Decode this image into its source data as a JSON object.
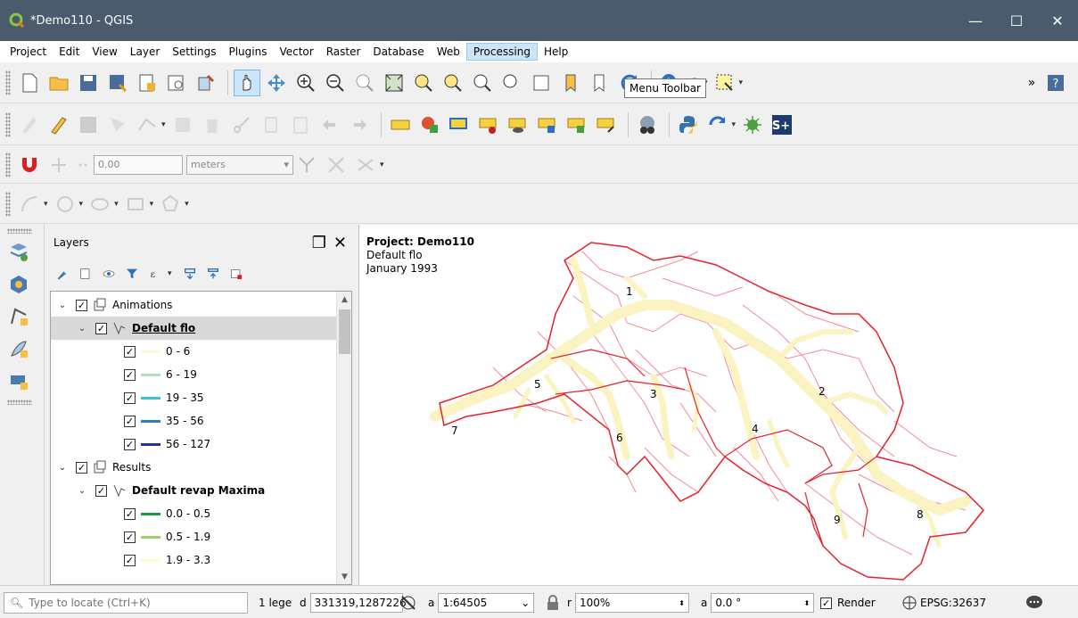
{
  "window": {
    "title": "*Demo110 - QGIS"
  },
  "menubar": {
    "items": [
      "Project",
      "Edit",
      "View",
      "Layer",
      "Settings",
      "Plugins",
      "Vector",
      "Raster",
      "Database",
      "Web",
      "Processing",
      "Help"
    ],
    "active": "Processing"
  },
  "tooltip": {
    "text": "Menu Toolbar"
  },
  "snapping": {
    "tolerance": "0.00",
    "units": "meters"
  },
  "layers_panel": {
    "title": "Layers",
    "tree": [
      {
        "label": "Animations",
        "kind": "group"
      },
      {
        "label": "Default flo",
        "kind": "layer"
      },
      {
        "label": "0 - 6",
        "color": "#fffacd"
      },
      {
        "label": "6 - 19",
        "color": "#a8e0c0"
      },
      {
        "label": "19 - 35",
        "color": "#40c0d0"
      },
      {
        "label": "35 - 56",
        "color": "#2a7fc0"
      },
      {
        "label": "56 - 127",
        "color": "#25339a"
      },
      {
        "label": "Results",
        "kind": "group"
      },
      {
        "label": "Default revap Maxima",
        "kind": "layer"
      },
      {
        "label": "0.0 - 0.5",
        "color": "#1a9a3a"
      },
      {
        "label": "0.5 - 1.9",
        "color": "#9ad36a"
      },
      {
        "label": "1.9 - 3.3",
        "color": "#fffacd"
      }
    ]
  },
  "map": {
    "title": "Project: Demo110",
    "subtitle": "Default flo",
    "date": "January 1993",
    "subbasin_labels": [
      "1",
      "2",
      "3",
      "4",
      "5",
      "6",
      "7",
      "8",
      "9"
    ],
    "colors": {
      "boundary": "#e8202a",
      "subbasin": "#f08a9a",
      "stream": "#fbf3c2"
    }
  },
  "statusbar": {
    "locator_placeholder": "Type to locate (Ctrl+K)",
    "legend_msg": "1 lege",
    "coord_label": "d",
    "coordinate": "331319,1287226",
    "scale_label": "a",
    "scale": "1:64505",
    "magnifier_label": "r",
    "magnifier": "100%",
    "rotation_label": "a",
    "rotation": "0.0 °",
    "render_label": "Render",
    "crs": "EPSG:32637"
  }
}
